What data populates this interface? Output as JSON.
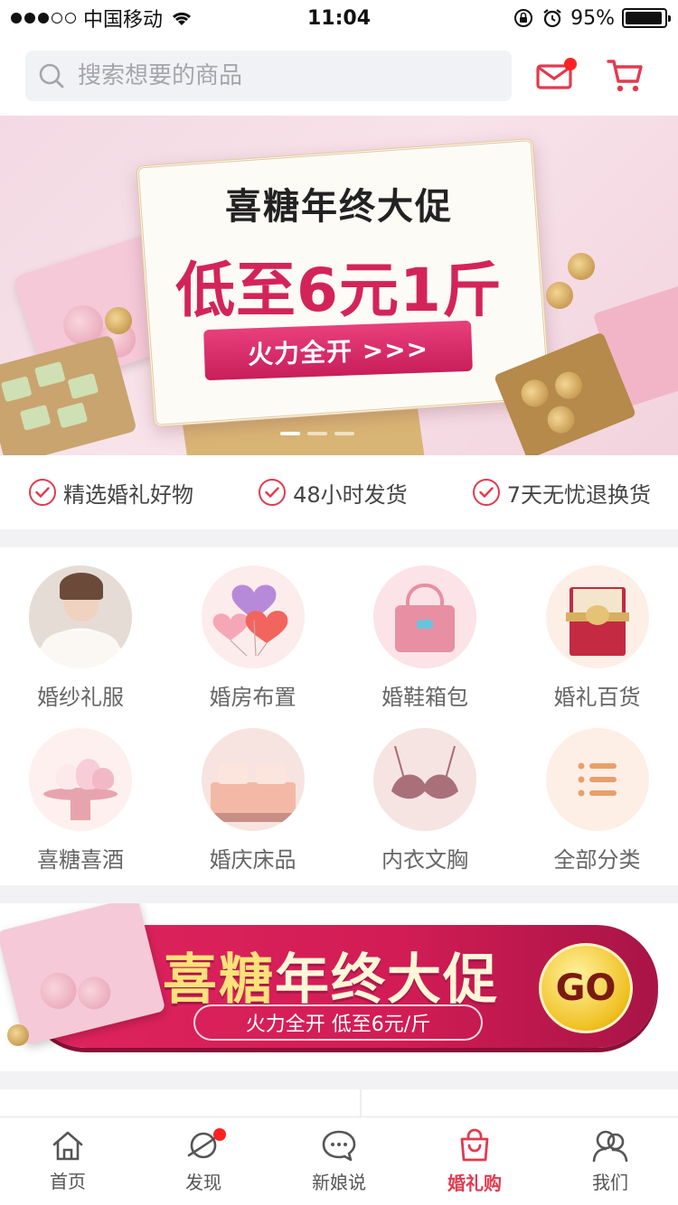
{
  "status_bar": {
    "carrier": "中国移动",
    "time": "11:04",
    "battery": "95%",
    "battery_level": 0.95
  },
  "header": {
    "search_placeholder": "搜索想要的商品",
    "mail_icon": "mail-icon",
    "cart_icon": "cart-icon",
    "colors": {
      "accent": "#e23a4f"
    }
  },
  "hero_banner": {
    "title_line1": "喜糖年终大促",
    "title_line2": "低至6元1斤",
    "cta": "火力全开 >>>",
    "slides_total": 3,
    "active_slide": 1
  },
  "promises": [
    {
      "label": "精选婚礼好物"
    },
    {
      "label": "48小时发货"
    },
    {
      "label": "7天无忧退换货"
    }
  ],
  "categories": [
    {
      "label": "婚纱礼服",
      "icon": "wedding-dress-icon"
    },
    {
      "label": "婚房布置",
      "icon": "heart-balloons-icon"
    },
    {
      "label": "婚鞋箱包",
      "icon": "handbag-icon"
    },
    {
      "label": "婚礼百货",
      "icon": "gift-box-icon"
    },
    {
      "label": "喜糖喜酒",
      "icon": "meringue-stand-icon"
    },
    {
      "label": "婚庆床品",
      "icon": "bed-icon"
    },
    {
      "label": "内衣文胸",
      "icon": "bra-icon"
    },
    {
      "label": "全部分类",
      "icon": "list-icon"
    }
  ],
  "promo_banner": {
    "title_a": "喜糖",
    "title_b": "年终大促",
    "subtitle": "火力全开  低至6元/斤",
    "go": "GO"
  },
  "tabbar": [
    {
      "label": "首页",
      "icon": "home-icon"
    },
    {
      "label": "发现",
      "icon": "planet-icon",
      "badge": true
    },
    {
      "label": "新娘说",
      "icon": "chat-bubble-icon"
    },
    {
      "label": "婚礼购",
      "icon": "shopping-bag-icon",
      "active": true
    },
    {
      "label": "我们",
      "icon": "couple-icon"
    }
  ]
}
